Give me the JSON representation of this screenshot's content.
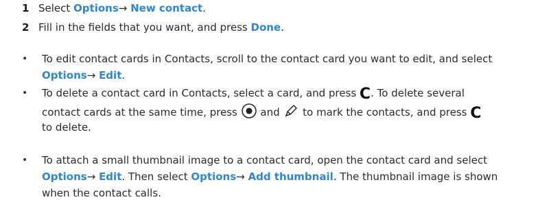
{
  "steps": [
    {
      "num": "1",
      "text1": "Select ",
      "opt": "Options",
      "arrow": "→ ",
      "opt2": "New contact",
      "end": "."
    },
    {
      "num": "2",
      "text1": "Fill in the fields that you want, and press ",
      "opt": "Done",
      "end": "."
    }
  ],
  "bullets": {
    "b1": {
      "l1": "To edit contact cards in Contacts, scroll to the contact card you want to edit, and select",
      "opt": "Options",
      "arrow": "→ ",
      "opt2": "Edit",
      "end": "."
    },
    "b2": {
      "l1a": "To delete a contact card in Contacts, select a card, and press ",
      "key1": "C",
      "l1b": ". To delete several",
      "l2a": "contact cards at the same time, press ",
      "l2b": " and ",
      "l2c": " to mark the contacts, and press ",
      "key2": "C",
      "l3": "to delete."
    },
    "b3": {
      "l1": "To attach a small thumbnail image to a contact card, open the contact card and select",
      "opt": "Options",
      "arrow": "→ ",
      "opt2": "Edit",
      "mid": ". Then select ",
      "opt3": "Options",
      "arrow2": "→ ",
      "opt4": "Add thumbnail",
      "tail": ". The thumbnail image is shown",
      "l3": "when the contact calls."
    }
  },
  "colors": {
    "accent": "#2f86d6",
    "text": "#2b2b2b"
  },
  "icons": [
    "joystick-press-icon",
    "edit-pen-icon"
  ]
}
